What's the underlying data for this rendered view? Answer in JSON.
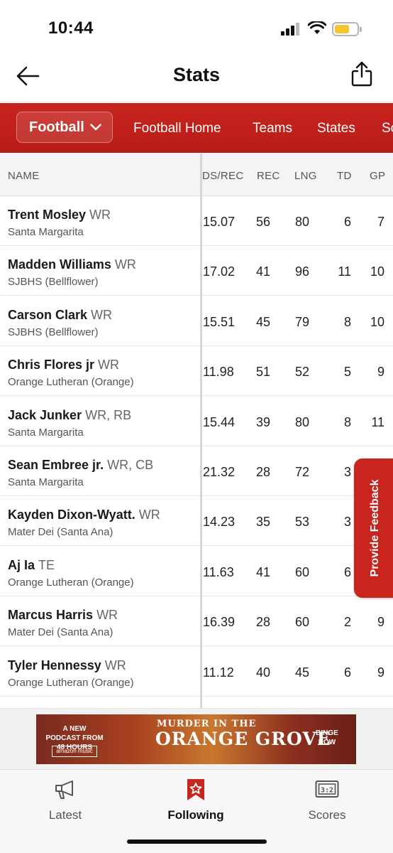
{
  "status_bar": {
    "time": "10:44"
  },
  "header": {
    "title": "Stats"
  },
  "sport_nav": {
    "selected_sport": "Football",
    "links": [
      "Football Home",
      "Teams",
      "States",
      "Sc"
    ]
  },
  "table": {
    "columns": {
      "name": "NAME",
      "yds_rec": "DS/REC",
      "rec": "REC",
      "lng": "LNG",
      "td": "TD",
      "gp": "GP"
    },
    "rows": [
      {
        "name": "Trent Mosley",
        "pos": "WR",
        "team": "Santa Margarita",
        "yds_rec": "15.07",
        "rec": "56",
        "lng": "80",
        "td": "6",
        "gp": "7"
      },
      {
        "name": "Madden Williams",
        "pos": "WR",
        "team": "SJBHS (Bellflower)",
        "yds_rec": "17.02",
        "rec": "41",
        "lng": "96",
        "td": "11",
        "gp": "10"
      },
      {
        "name": "Carson Clark",
        "pos": "WR",
        "team": "SJBHS (Bellflower)",
        "yds_rec": "15.51",
        "rec": "45",
        "lng": "79",
        "td": "8",
        "gp": "10"
      },
      {
        "name": "Chris Flores jr",
        "pos": "WR",
        "team": "Orange Lutheran (Orange)",
        "yds_rec": "11.98",
        "rec": "51",
        "lng": "52",
        "td": "5",
        "gp": "9"
      },
      {
        "name": "Jack Junker",
        "pos": "WR, RB",
        "team": "Santa Margarita",
        "yds_rec": "15.44",
        "rec": "39",
        "lng": "80",
        "td": "8",
        "gp": "11"
      },
      {
        "name": "Sean Embree jr.",
        "pos": "WR, CB",
        "team": "Santa Margarita",
        "yds_rec": "21.32",
        "rec": "28",
        "lng": "72",
        "td": "3",
        "gp": ""
      },
      {
        "name": "Kayden Dixon-Wyatt.",
        "pos": "WR",
        "team": "Mater Dei (Santa Ana)",
        "yds_rec": "14.23",
        "rec": "35",
        "lng": "53",
        "td": "3",
        "gp": ""
      },
      {
        "name": "Aj Ia",
        "pos": "TE",
        "team": "Orange Lutheran (Orange)",
        "yds_rec": "11.63",
        "rec": "41",
        "lng": "60",
        "td": "6",
        "gp": ""
      },
      {
        "name": "Marcus Harris",
        "pos": "WR",
        "team": "Mater Dei (Santa Ana)",
        "yds_rec": "16.39",
        "rec": "28",
        "lng": "60",
        "td": "2",
        "gp": "9"
      },
      {
        "name": "Tyler Hennessy",
        "pos": "WR",
        "team": "Orange Lutheran (Orange)",
        "yds_rec": "11.12",
        "rec": "40",
        "lng": "45",
        "td": "6",
        "gp": "9"
      }
    ]
  },
  "feedback": {
    "label": "Provide Feedback"
  },
  "ad": {
    "left_text": "A NEW PODCAST FROM 48 HOURS",
    "music_label": "amazon music",
    "title_top": "MURDER IN THE",
    "title_main": "ORANGE GROVE",
    "cta": "BINGE NOW"
  },
  "tabbar": {
    "tabs": [
      {
        "label": "Latest",
        "icon": "megaphone-icon"
      },
      {
        "label": "Following",
        "icon": "star-bookmark-icon"
      },
      {
        "label": "Scores",
        "icon": "scoreboard-icon"
      }
    ],
    "active_index": 1
  },
  "colors": {
    "accent": "#c8251f",
    "header_bg": "#f4f4f6"
  }
}
